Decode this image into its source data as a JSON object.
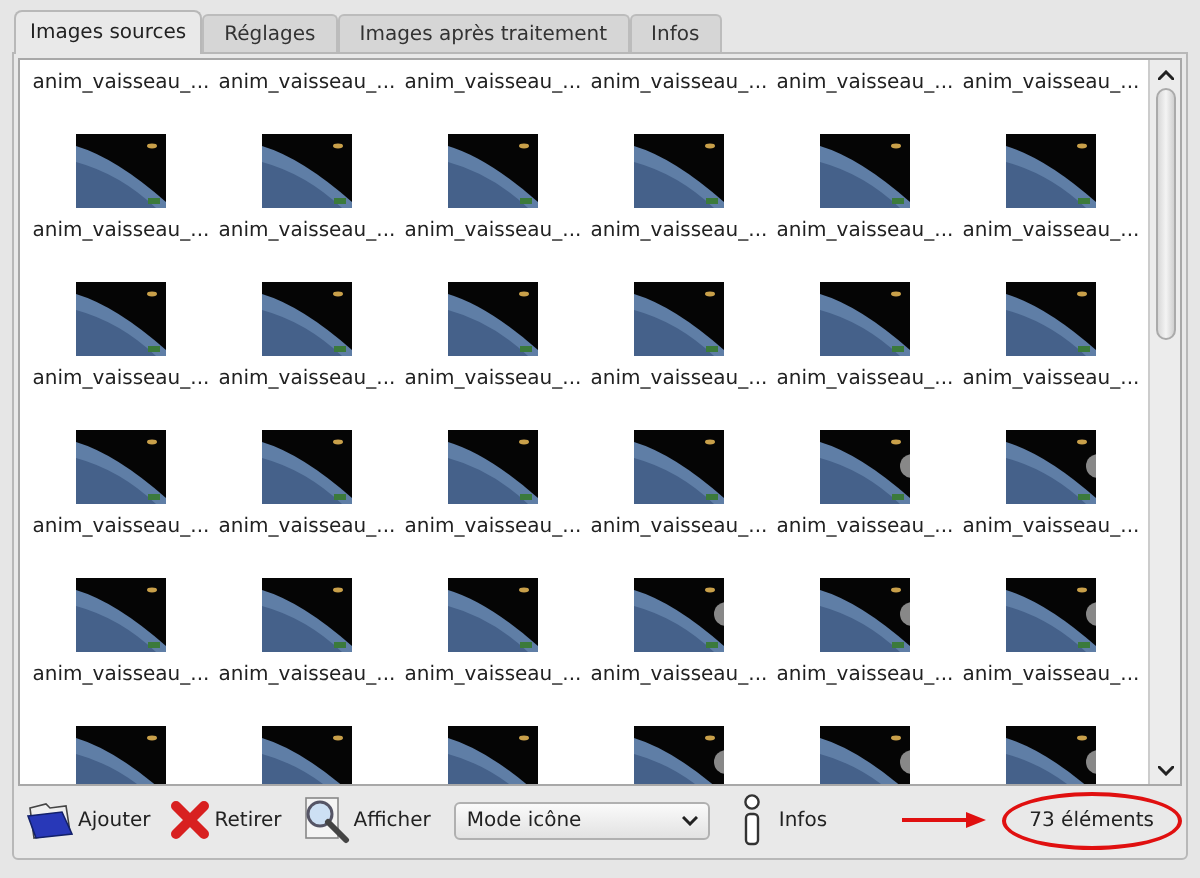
{
  "tabs": [
    {
      "label": "Images sources",
      "selected": true
    },
    {
      "label": "Réglages",
      "selected": false
    },
    {
      "label": "Images après traitement",
      "selected": false
    },
    {
      "label": "Infos",
      "selected": false
    }
  ],
  "thumbnails": [
    {
      "kind": "labeled",
      "label": "anim_vaisseau_..."
    },
    {
      "kind": "labeled",
      "label": "anim_vaisseau_..."
    },
    {
      "kind": "labeled",
      "label": "anim_vaisseau_..."
    },
    {
      "kind": "labeled",
      "label": "anim_vaisseau_..."
    },
    {
      "kind": "labeled",
      "label": "anim_vaisseau_..."
    },
    {
      "kind": "labeled",
      "label": "anim_vaisseau_..."
    },
    {
      "kind": "labeled",
      "label": "anim_vaisseau_..."
    },
    {
      "kind": "labeled",
      "label": "anim_vaisseau_..."
    },
    {
      "kind": "labeled",
      "label": "anim_vaisseau_..."
    },
    {
      "kind": "labeled",
      "label": "anim_vaisseau_..."
    },
    {
      "kind": "labeled",
      "label": "anim_vaisseau_..."
    },
    {
      "kind": "labeled",
      "label": "anim_vaisseau_..."
    },
    {
      "kind": "labeled",
      "label": "anim_vaisseau_..."
    },
    {
      "kind": "labeled",
      "label": "anim_vaisseau_..."
    },
    {
      "kind": "labeled",
      "label": "anim_vaisseau_..."
    },
    {
      "kind": "labeled",
      "label": "anim_vaisseau_..."
    },
    {
      "kind": "labeled",
      "label": "anim_vaisseau_..."
    },
    {
      "kind": "labeled",
      "label": "anim_vaisseau_..."
    },
    {
      "kind": "labeled",
      "label": "anim_vaisseau_..."
    },
    {
      "kind": "labeled",
      "label": "anim_vaisseau_..."
    },
    {
      "kind": "labeled",
      "label": "anim_vaisseau_..."
    },
    {
      "kind": "labeled",
      "label": "anim_vaisseau_..."
    },
    {
      "kind": "labeled",
      "label": "anim_vaisseau_..."
    },
    {
      "kind": "labeled",
      "label": "anim_vaisseau_..."
    },
    {
      "kind": "labeled",
      "label": "anim_vaisseau_..."
    },
    {
      "kind": "labeled",
      "label": "anim_vaisseau_..."
    },
    {
      "kind": "labeled",
      "label": "anim_vaisseau_..."
    },
    {
      "kind": "labeled",
      "label": "anim_vaisseau_..."
    },
    {
      "kind": "labeled",
      "label": "anim_vaisseau_..."
    },
    {
      "kind": "labeled",
      "label": "anim_vaisseau_..."
    },
    {
      "kind": "unlabeled"
    },
    {
      "kind": "unlabeled"
    },
    {
      "kind": "unlabeled"
    },
    {
      "kind": "unlabeled"
    },
    {
      "kind": "unlabeled"
    },
    {
      "kind": "unlabeled"
    }
  ],
  "toolbar": {
    "buttons": [
      {
        "kind": "add",
        "label": "Ajouter"
      },
      {
        "kind": "remove",
        "label": "Retirer"
      },
      {
        "kind": "view",
        "label": "Afficher"
      }
    ],
    "view_mode": {
      "value": "Mode icône"
    },
    "info_button": {
      "label": "Infos"
    },
    "count": "73 éléments"
  }
}
